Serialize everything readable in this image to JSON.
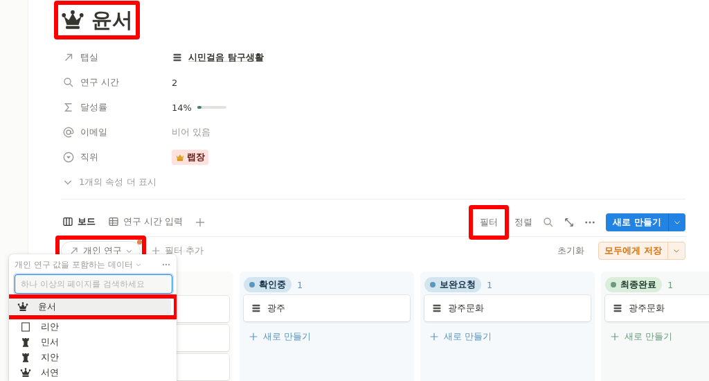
{
  "title": {
    "kind": "queen",
    "text": "윤서",
    "highlighted": true
  },
  "properties": [
    {
      "label": "탭실",
      "kind": "relation",
      "value": "시민걸음 탐구생활"
    },
    {
      "label": "연구 시간",
      "kind": "text",
      "value": "2"
    },
    {
      "label": "달성률",
      "kind": "progress",
      "value": "14%",
      "level": 0.14
    },
    {
      "label": "이메일",
      "kind": "empty",
      "value": "비어 있음"
    },
    {
      "label": "직위",
      "kind": "tag",
      "value": "랩장"
    }
  ],
  "more_properties": "1개의 속성 더 표시",
  "views": [
    {
      "label": "보드",
      "selected": true
    },
    {
      "label": "연구 시간 입력",
      "selected": false
    }
  ],
  "toolbar": {
    "filter": {
      "label": "필터",
      "highlighted": true
    },
    "sort": "정렬",
    "new_button": "새로 만들기"
  },
  "filter_bar": {
    "chip": {
      "label": "개인 연구",
      "highlighted": true,
      "modified": true
    },
    "add_filter": "필터 추가",
    "reset": "초기화",
    "save_button": "모두에게 저장"
  },
  "board": {
    "columns": [
      {
        "kind": "covered"
      },
      {
        "label": "확인중",
        "color": "#5b97bd",
        "count": "1",
        "cards": [
          {
            "title": "광주"
          }
        ],
        "add_label": "새로 만들기"
      },
      {
        "label": "보완요청",
        "color": "#5b97bd",
        "count": "1",
        "cards": [
          {
            "title": "광주문화"
          }
        ],
        "add_label": "새로 만들기"
      },
      {
        "label": "최종완료",
        "color": "#6c9b7d",
        "count": "1",
        "cards": [
          {
            "title": "광주문화"
          }
        ],
        "add_label": "새로 만들기"
      }
    ]
  },
  "popup": {
    "heading": "개인 연구 값을 포함하는 데이터",
    "search": {
      "placeholder": "하나 이상의 페이지를 검색하세요"
    },
    "items": [
      {
        "kind": "queen",
        "label": "윤서",
        "selected": true,
        "highlighted": true
      },
      {
        "kind": "page",
        "label": "리안",
        "selected": false,
        "highlighted": false
      },
      {
        "kind": "rook",
        "label": "민서",
        "selected": false,
        "highlighted": false
      },
      {
        "kind": "rook",
        "label": "지안",
        "selected": false,
        "highlighted": false
      },
      {
        "kind": "queen",
        "label": "서연",
        "selected": false,
        "highlighted": false
      }
    ]
  }
}
